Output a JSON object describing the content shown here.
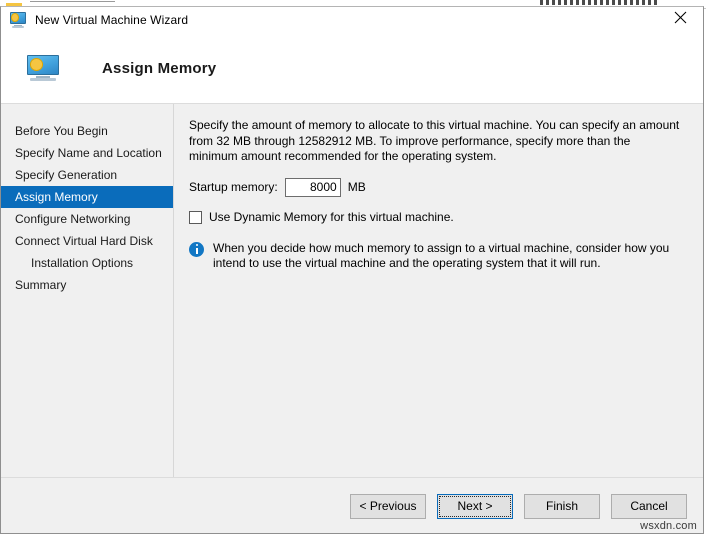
{
  "window": {
    "title": "New Virtual Machine Wizard",
    "title_icon": "virtual-machine-monitor-icon",
    "close_icon": "close-icon",
    "accent_color": "#0a6cbb",
    "background_color": "#f0f0f0"
  },
  "header": {
    "icon": "virtual-machine-monitor-icon",
    "title": "Assign Memory"
  },
  "sidebar": {
    "items": [
      {
        "label": "Before You Begin",
        "selected": false,
        "indent": false
      },
      {
        "label": "Specify Name and Location",
        "selected": false,
        "indent": false
      },
      {
        "label": "Specify Generation",
        "selected": false,
        "indent": false
      },
      {
        "label": "Assign Memory",
        "selected": true,
        "indent": false
      },
      {
        "label": "Configure Networking",
        "selected": false,
        "indent": false
      },
      {
        "label": "Connect Virtual Hard Disk",
        "selected": false,
        "indent": false
      },
      {
        "label": "Installation Options",
        "selected": false,
        "indent": true
      },
      {
        "label": "Summary",
        "selected": false,
        "indent": false
      }
    ]
  },
  "main": {
    "description": "Specify the amount of memory to allocate to this virtual machine. You can specify an amount from 32 MB through 12582912 MB. To improve performance, specify more than the minimum amount recommended for the operating system.",
    "memory_field": {
      "label": "Startup memory:",
      "value": "8000",
      "placeholder": "",
      "unit": "MB"
    },
    "dynamic_memory": {
      "label": "Use Dynamic Memory for this virtual machine.",
      "checked": false
    },
    "note": {
      "icon": "info-icon",
      "text": "When you decide how much memory to assign to a virtual machine, consider how you intend to use the virtual machine and the operating system that it will run."
    }
  },
  "footer": {
    "buttons": [
      {
        "label": "< Previous",
        "default": false
      },
      {
        "label": "Next >",
        "default": true
      },
      {
        "label": "Finish",
        "default": false
      },
      {
        "label": "Cancel",
        "default": false
      }
    ]
  },
  "watermark": "wsxdn.com"
}
